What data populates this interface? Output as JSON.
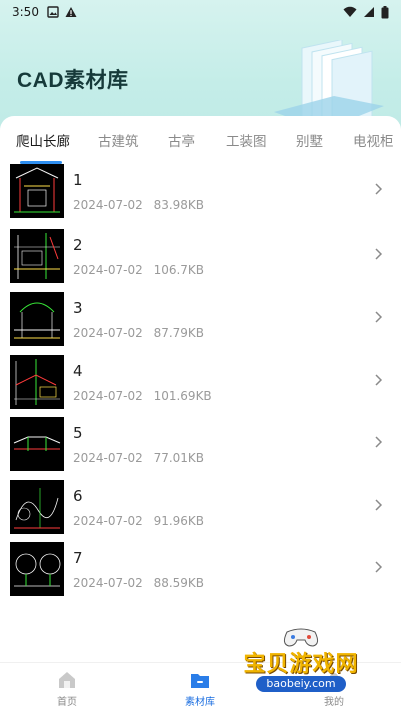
{
  "status_bar": {
    "time": "3:50",
    "left_icons": [
      "image-icon",
      "warning-icon"
    ],
    "right_icons": [
      "wifi-icon",
      "signal-icon",
      "battery-icon"
    ]
  },
  "header": {
    "title": "CAD素材库"
  },
  "tabs": [
    {
      "label": "爬山长廊",
      "active": true
    },
    {
      "label": "古建筑",
      "active": false
    },
    {
      "label": "古亭",
      "active": false
    },
    {
      "label": "工装图",
      "active": false
    },
    {
      "label": "别墅",
      "active": false
    },
    {
      "label": "电视柜",
      "active": false
    }
  ],
  "items": [
    {
      "name": "1",
      "date": "2024-07-02",
      "size": "83.98KB"
    },
    {
      "name": "2",
      "date": "2024-07-02",
      "size": "106.7KB"
    },
    {
      "name": "3",
      "date": "2024-07-02",
      "size": "87.79KB"
    },
    {
      "name": "4",
      "date": "2024-07-02",
      "size": "101.69KB"
    },
    {
      "name": "5",
      "date": "2024-07-02",
      "size": "77.01KB"
    },
    {
      "name": "6",
      "date": "2024-07-02",
      "size": "91.96KB"
    },
    {
      "name": "7",
      "date": "2024-07-02",
      "size": "88.59KB"
    }
  ],
  "bottom_nav": [
    {
      "label": "首页",
      "icon": "home-icon",
      "active": false
    },
    {
      "label": "素材库",
      "icon": "folder-icon",
      "active": true
    },
    {
      "label": "我的",
      "icon": "user-icon",
      "active": false
    }
  ],
  "watermark": {
    "text": "宝贝游戏网",
    "url": "baobeiy.com"
  },
  "colors": {
    "accent": "#2f8ff0",
    "nav_active": "#1d6fe0",
    "header_bg": "#c4ede8",
    "title": "#163a3a"
  }
}
